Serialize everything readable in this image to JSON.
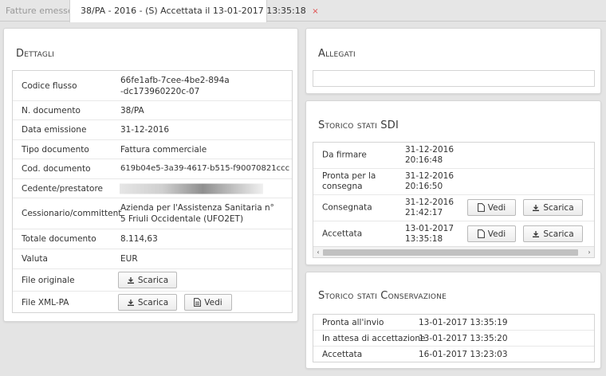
{
  "tabs": [
    {
      "label": "Fatture emesse"
    },
    {
      "label": "38/PA - 2016 - (S) Accettata il 13-01-2017 13:35:18",
      "close": "×"
    }
  ],
  "dettagli": {
    "title": "Dettagli",
    "rows": {
      "codice_flusso": {
        "label": "Codice flusso",
        "value": "66fe1afb-7cee-4be2-894a-dc173960220c-07"
      },
      "n_documento": {
        "label": "N. documento",
        "value": "38/PA"
      },
      "data_emissione": {
        "label": "Data emissione",
        "value": "31-12-2016"
      },
      "tipo_documento": {
        "label": "Tipo documento",
        "value": "Fattura commerciale"
      },
      "cod_documento": {
        "label": "Cod. documento",
        "value": "619b04e5-3a39-4617-b515-f90070821ccc"
      },
      "cedente": {
        "label": "Cedente/prestatore"
      },
      "cessionario": {
        "label": "Cessionario/committent",
        "value": "Azienda per l'Assistenza Sanitaria n° 5 Friuli Occidentale (UFO2ET)"
      },
      "totale": {
        "label": "Totale documento",
        "value": "8.114,63"
      },
      "valuta": {
        "label": "Valuta",
        "value": "EUR"
      },
      "file_originale": {
        "label": "File originale",
        "scarica": "Scarica"
      },
      "file_xml": {
        "label": "File XML-PA",
        "scarica": "Scarica",
        "vedi": "Vedi"
      }
    }
  },
  "allegati": {
    "title": "Allegati"
  },
  "storico_sdi": {
    "title": "Storico stati SDI",
    "rows": [
      {
        "stato": "Da firmare",
        "data": "31-12-2016",
        "ora": "20:16:48"
      },
      {
        "stato": "Pronta per la consegna",
        "data": "31-12-2016",
        "ora": "20:16:50"
      },
      {
        "stato": "Consegnata",
        "data": "31-12-2016",
        "ora": "21:42:17",
        "vedi": "Vedi",
        "scarica": "Scarica"
      },
      {
        "stato": "Accettata",
        "data": "13-01-2017",
        "ora": "13:35:18",
        "vedi": "Vedi",
        "scarica": "Scarica"
      }
    ],
    "scroll_left": "‹",
    "scroll_right": "›"
  },
  "storico_conservazione": {
    "title": "Storico stati Conservazione",
    "rows": [
      {
        "stato": "Pronta all'invio",
        "data": "13-01-2017 13:35:19"
      },
      {
        "stato": "In attesa di accettazione",
        "data": "13-01-2017 13:35:20"
      },
      {
        "stato": "Accettata",
        "data": "16-01-2017 13:23:03"
      }
    ]
  },
  "colors": {
    "close_x": "#e04a4a",
    "background": "#e4e4e4",
    "panel_border": "#d6d6d6"
  },
  "icons": {
    "scarica": "download-icon",
    "vedi": "document-icon"
  }
}
